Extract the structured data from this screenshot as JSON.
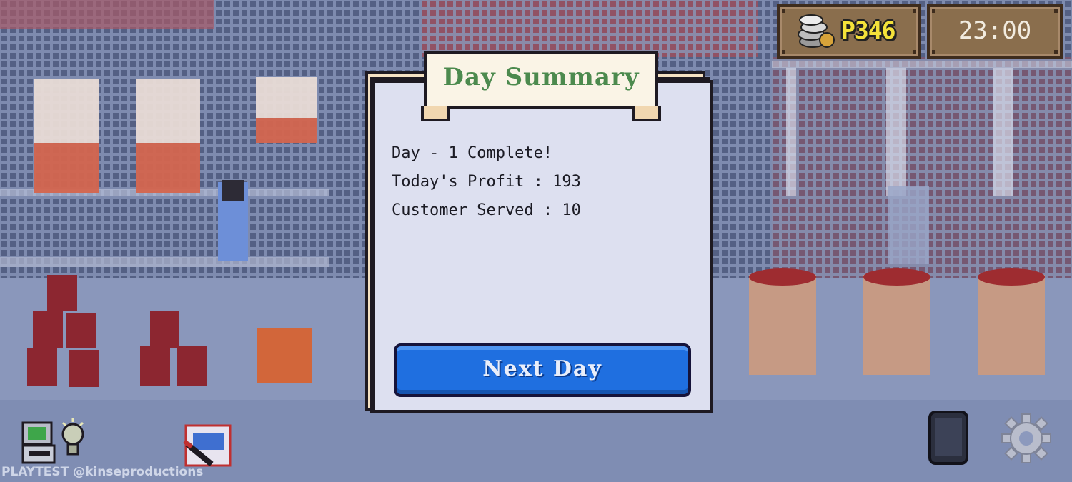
{
  "hud": {
    "money": "P346",
    "clock": "23:00",
    "coin_icon": "coin-stack-icon"
  },
  "dialog": {
    "title": "Day Summary",
    "lines": [
      "Day - 1 Complete!",
      "Today's Profit : 193",
      "Customer Served : 10"
    ],
    "next_button": "Next Day"
  },
  "toolbar": {
    "left_icons": [
      "computer-icon",
      "lightbulb-icon",
      "snack-bag-icon"
    ],
    "right_icons": [
      "phone-icon",
      "gear-icon"
    ]
  },
  "watermark": "PLAYTEST @kinseproductions",
  "colors": {
    "money_text": "#f4e23a",
    "title_text": "#4c8a4e",
    "button": "#1f6fe0",
    "panel": "#dde0f0"
  }
}
